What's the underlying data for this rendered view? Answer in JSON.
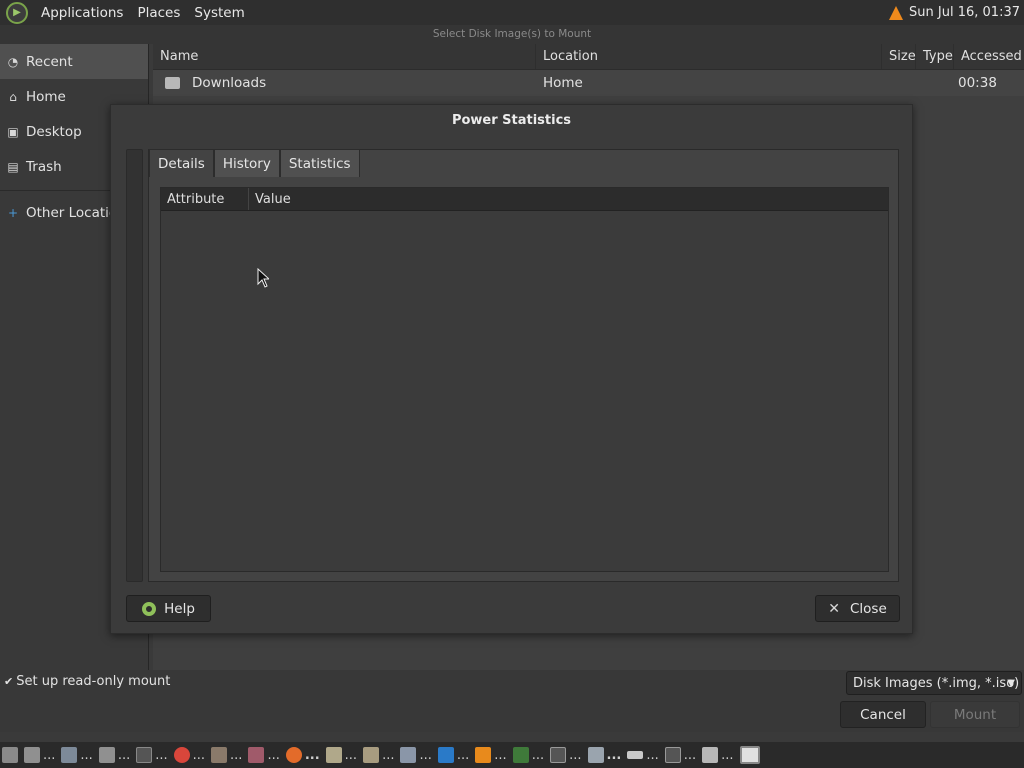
{
  "top_panel": {
    "menus": [
      "Applications",
      "Places",
      "System"
    ],
    "clock": "Sun Jul 16, 01:37"
  },
  "file_chooser": {
    "title": "Select Disk Image(s) to Mount",
    "places": [
      {
        "label": "Recent",
        "icon": "recent-icon"
      },
      {
        "label": "Home",
        "icon": "home-icon"
      },
      {
        "label": "Desktop",
        "icon": "desktop-icon"
      },
      {
        "label": "Trash",
        "icon": "trash-icon"
      },
      {
        "label": "Other Locations",
        "icon": "plus-icon"
      }
    ],
    "columns": [
      "Name",
      "Location",
      "Size",
      "Type",
      "Accessed"
    ],
    "rows": [
      {
        "name": "Downloads",
        "location": "Home",
        "size": "",
        "type": "",
        "accessed": "00:38"
      }
    ],
    "readonly_label": "Set up read-only mount",
    "filter": "Disk Images (*.img, *.iso)",
    "cancel_label": "Cancel",
    "mount_label": "Mount"
  },
  "dialog": {
    "title": "Power Statistics",
    "tabs": [
      "Details",
      "History",
      "Statistics"
    ],
    "active_tab": "Details",
    "columns": [
      "Attribute",
      "Value"
    ],
    "help_label": "Help",
    "close_label": "Close"
  },
  "taskbar": {
    "dots": "..."
  },
  "colors": {
    "accent_green": "#8fc05a",
    "vlc_orange": "#f08a1c"
  }
}
